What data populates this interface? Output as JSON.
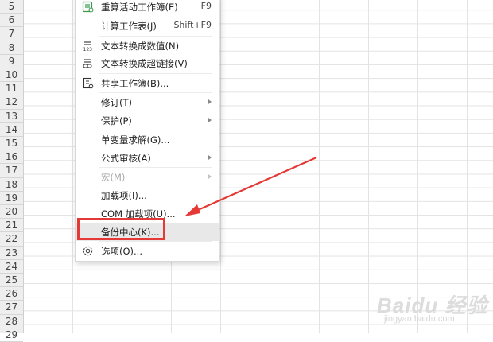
{
  "rows": [
    "5",
    "6",
    "7",
    "8",
    "9",
    "10",
    "11",
    "12",
    "13",
    "14",
    "15",
    "16",
    "17",
    "18",
    "19",
    "20",
    "21",
    "22",
    "23",
    "24",
    "25",
    "26",
    "27",
    "28",
    "29"
  ],
  "menu": {
    "items": [
      {
        "label": "重算活动工作簿(E)",
        "shortcut": "F9",
        "icon": "recalc-workbook-icon"
      },
      {
        "label": "计算工作表(J)",
        "shortcut": "Shift+F9"
      },
      {
        "label": "文本转换成数值(N)",
        "icon": "text-to-number-icon"
      },
      {
        "label": "文本转换成超链接(V)",
        "icon": "text-to-link-icon"
      },
      {
        "label": "共享工作簿(B)...",
        "icon": "share-workbook-icon"
      },
      {
        "label": "修订(T)",
        "submenu": true
      },
      {
        "label": "保护(P)",
        "submenu": true
      },
      {
        "label": "单变量求解(G)..."
      },
      {
        "label": "公式审核(A)",
        "submenu": true
      },
      {
        "label": "宏(M)",
        "submenu": true,
        "disabled": true
      },
      {
        "label": "加载项(I)..."
      },
      {
        "label": "COM 加载项(U)..."
      },
      {
        "label": "备份中心(K)...",
        "highlighted": true
      },
      {
        "label": "选项(O)...",
        "icon": "gear-icon"
      }
    ]
  },
  "colors": {
    "highlight_box": "#e53935",
    "arrow": "#e53935",
    "hover": "#e8e8e8"
  },
  "watermark": {
    "logo": "Baidu 经验",
    "url": "jingyan.baidu.com"
  }
}
